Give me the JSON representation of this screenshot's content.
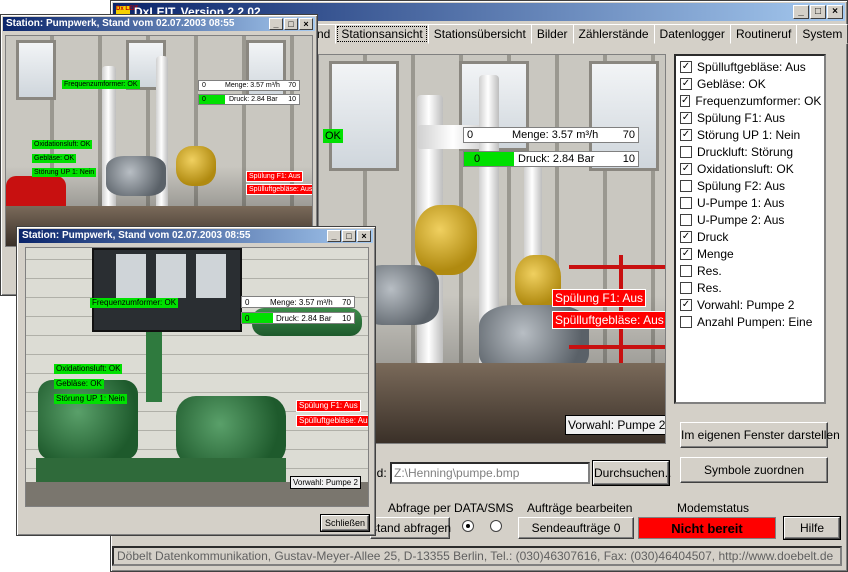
{
  "main": {
    "title": "DxLEIT, Version 2.2.02",
    "app_icon_text": "Dx LEIT",
    "tabs": [
      "nd",
      "Stationsansicht",
      "Stationsübersicht",
      "Bilder",
      "Zählerstände",
      "Datenlogger",
      "Routineruf",
      "System"
    ],
    "scene_labels": {
      "ok": "OK",
      "menge": "Menge: 3.57 m³/h",
      "menge_min": "0",
      "menge_max": "70",
      "druck": "Druck: 2.84 Bar",
      "druck_min": "0",
      "druck_max": "10",
      "spuelung": "Spülung F1: Aus",
      "spuelluft": "Spülluftgebläse: Aus",
      "vorwahl": "Vorwahl: Pumpe 2"
    },
    "checkboxes": [
      {
        "label": "Spülluftgebläse: Aus",
        "checked": true
      },
      {
        "label": "Gebläse: OK",
        "checked": true
      },
      {
        "label": "Frequenzumformer: OK",
        "checked": true
      },
      {
        "label": "Spülung F1: Aus",
        "checked": true
      },
      {
        "label": "Störung UP 1: Nein",
        "checked": true
      },
      {
        "label": "Druckluft: Störung",
        "checked": false
      },
      {
        "label": "Oxidationsluft: OK",
        "checked": true
      },
      {
        "label": "Spülung F2: Aus",
        "checked": false
      },
      {
        "label": "U-Pumpe 1: Aus",
        "checked": false
      },
      {
        "label": "U-Pumpe 2: Aus",
        "checked": false
      },
      {
        "label": "Druck",
        "checked": true
      },
      {
        "label": "Menge",
        "checked": true
      },
      {
        "label": "Res.",
        "checked": false
      },
      {
        "label": "Res.",
        "checked": false
      },
      {
        "label": "Vorwahl: Pumpe 2",
        "checked": true
      },
      {
        "label": "Anzahl Pumpen: Eine",
        "checked": false
      }
    ],
    "btn_own_window": "Im eigenen Fenster darstellen",
    "btn_assign_symbols": "Symbole zuordnen",
    "file_label": "ld:",
    "file_path": "Z:\\Henning\\pumpe.bmp",
    "btn_browse": "Durchsuchen..",
    "abfrage_label": "Abfrage per",
    "data_sms_label": "DATA/SMS",
    "btn_stand": "stand abfragen",
    "auftraege_label": "Aufträge bearbeiten",
    "btn_send": "Sendeaufträge 0",
    "modem_label": "Modemstatus",
    "modem_status": "Nicht bereit",
    "modem_color": "#ff0000",
    "btn_help": "Hilfe",
    "statusbar": "Döbelt Datenkommunikation, Gustav-Meyer-Allee 25, D-13355 Berlin, Tel.: (030)46307616, Fax: (030)46404507, http://www.doebelt.de"
  },
  "win1": {
    "title": "Station: Pumpwerk, Stand vom 02.07.2003    08:55",
    "labels": {
      "freq": "Frequenzumformer: OK",
      "menge": "Menge: 3.57 m³/h",
      "menge_min": "0",
      "menge_max": "70",
      "druck": "Druck: 2.84 Bar",
      "druck_min": "0",
      "druck_max": "10",
      "oxi": "Oxidationsluft: OK",
      "geblaese": "Gebläse: OK",
      "stoerung": "Störung UP 1: Nein",
      "spuelung": "Spülung F1: Aus",
      "spuelluft": "Spülluftgebläse: Aus"
    }
  },
  "win2": {
    "title": "Station: Pumpwerk, Stand vom 02.07.2003    08:55",
    "labels": {
      "freq": "Frequenzumformer: OK",
      "menge": "Menge: 3.57 m³/h",
      "menge_min": "0",
      "menge_max": "70",
      "druck": "Druck: 2.84 Bar",
      "druck_min": "0",
      "druck_max": "10",
      "oxi": "Oxidationsluft: OK",
      "geblaese": "Gebläse: OK",
      "stoerung": "Störung UP 1: Nein",
      "spuelung": "Spülung F1: Aus",
      "spuelluft": "Spülluftgebläse: Aus",
      "vorwahl": "Vorwahl: Pumpe 2"
    },
    "btn_close": "Schließen"
  },
  "icons": {
    "minimize": "_",
    "maximize": "□",
    "close": "×",
    "check": "✓"
  }
}
